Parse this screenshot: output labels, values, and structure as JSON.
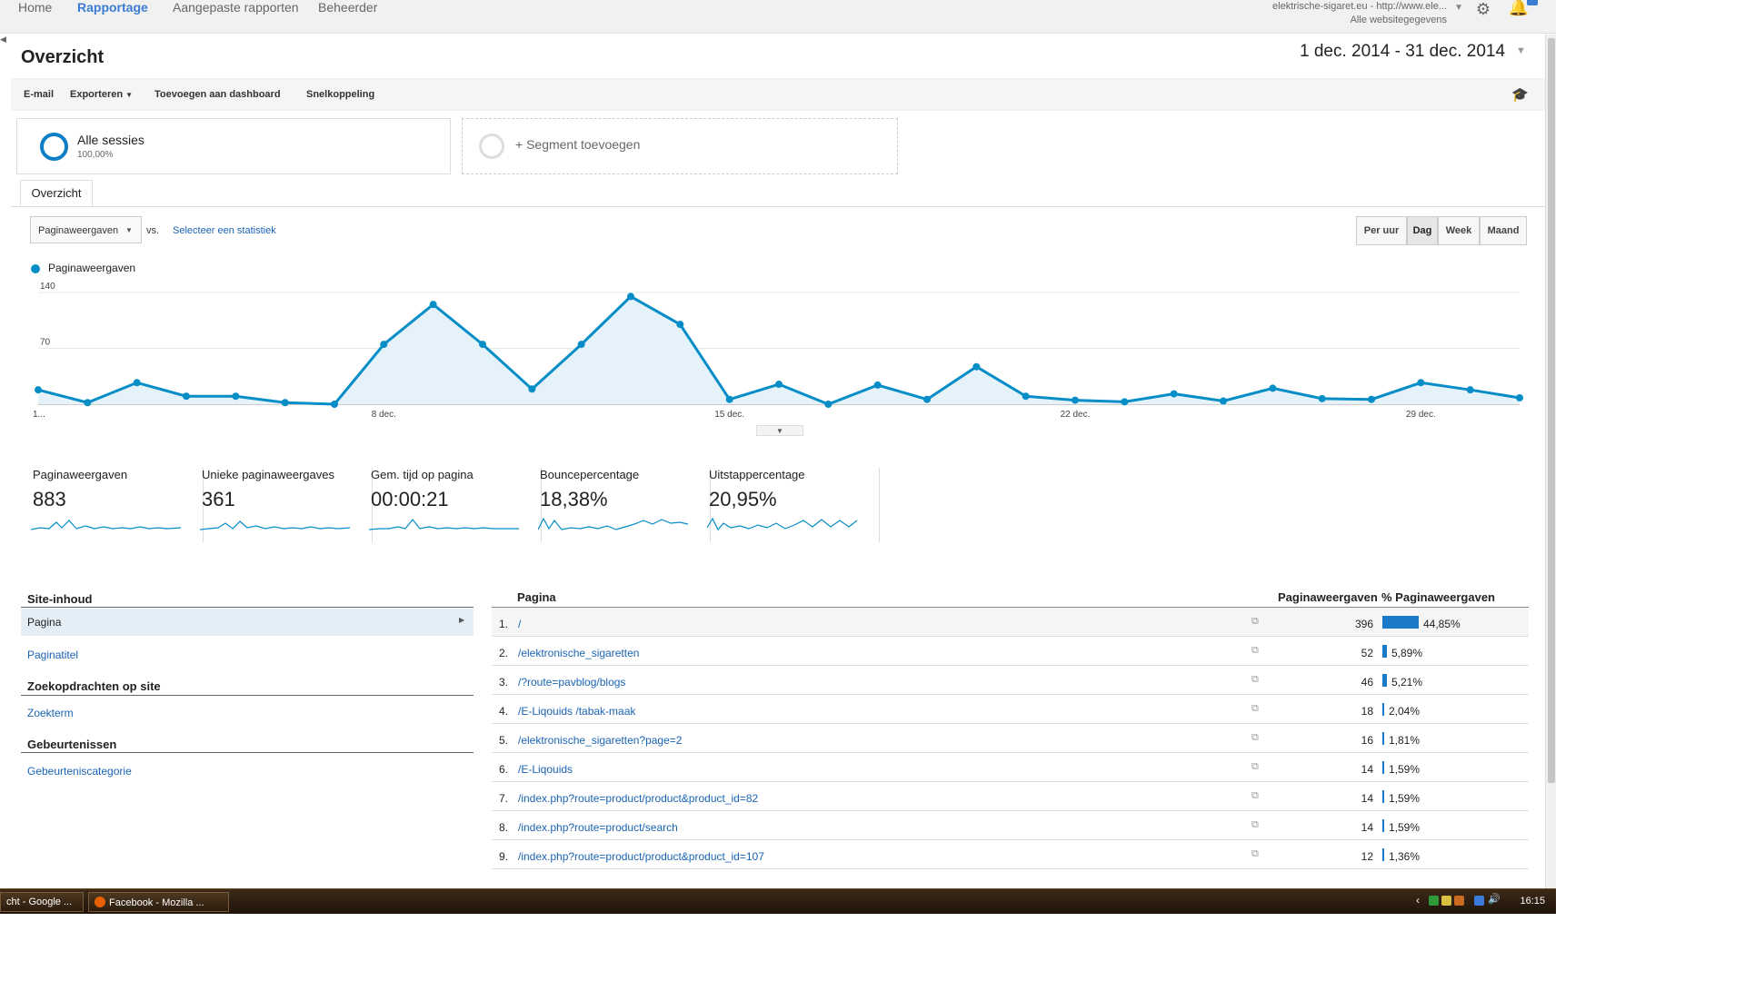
{
  "nav": {
    "home": "Home",
    "rapportage": "Rapportage",
    "aangepaste": "Aangepaste rapporten",
    "beheerder": "Beheerder"
  },
  "account": {
    "site": "elektrische-sigaret.eu - http://www.ele...",
    "view": "Alle websitegegevens"
  },
  "header": {
    "title": "Overzicht",
    "date_range": "1 dec. 2014 - 31 dec. 2014"
  },
  "toolbar": {
    "email": "E-mail",
    "export": "Exporteren",
    "add_dashboard": "Toevoegen aan dashboard",
    "shortcut": "Snelkoppeling"
  },
  "segments": {
    "active_title": "Alle sessies",
    "active_pct": "100,00%",
    "add": "+ Segment toevoegen"
  },
  "tabs": {
    "overview": "Overzicht"
  },
  "metric_controls": {
    "selected_metric": "Paginaweergaven",
    "vs": "vs.",
    "select_stat": "Selecteer een statistiek",
    "granularity": [
      "Per uur",
      "Dag",
      "Week",
      "Maand"
    ],
    "active_granularity": "Dag"
  },
  "colors": {
    "accent": "#058dc7",
    "link": "#1a64b4",
    "bar": "#1a7ac9"
  },
  "chart_data": {
    "type": "area",
    "series": [
      {
        "name": "Paginaweergaven",
        "values": [
          18,
          2,
          27,
          10,
          10,
          2,
          0,
          75,
          125,
          75,
          19,
          75,
          135,
          100,
          6,
          25,
          0,
          24,
          6,
          47,
          10,
          5,
          3,
          13,
          4,
          20,
          7,
          6,
          27,
          18,
          8
        ]
      }
    ],
    "x": [
      "1 dec.",
      "2 dec.",
      "3 dec.",
      "4 dec.",
      "5 dec.",
      "6 dec.",
      "7 dec.",
      "8 dec.",
      "9 dec.",
      "10 dec.",
      "11 dec.",
      "12 dec.",
      "13 dec.",
      "14 dec.",
      "15 dec.",
      "16 dec.",
      "17 dec.",
      "18 dec.",
      "19 dec.",
      "20 dec.",
      "21 dec.",
      "22 dec.",
      "23 dec.",
      "24 dec.",
      "25 dec.",
      "26 dec.",
      "27 dec.",
      "28 dec.",
      "29 dec.",
      "30 dec.",
      "31 dec."
    ],
    "x_tick_labels": [
      "1...",
      "8 dec.",
      "15 dec.",
      "22 dec.",
      "29 dec."
    ],
    "y_tick_labels": [
      "140",
      "70"
    ],
    "ylim": [
      0,
      140
    ],
    "grid": true,
    "legend": "top-left"
  },
  "scorecards": [
    {
      "label": "Paginaweergaven",
      "value": "883"
    },
    {
      "label": "Unieke paginaweergaves",
      "value": "361"
    },
    {
      "label": "Gem. tijd op pagina",
      "value": "00:00:21"
    },
    {
      "label": "Bouncepercentage",
      "value": "18,38%"
    },
    {
      "label": "Uitstappercentage",
      "value": "20,95%"
    }
  ],
  "left_panel": {
    "site_content": "Site-inhoud",
    "pagina": "Pagina",
    "paginatitel": "Paginatitel",
    "search_head": "Zoekopdrachten op site",
    "zoekterm": "Zoekterm",
    "events_head": "Gebeurtenissen",
    "event_category": "Gebeurteniscategorie"
  },
  "table": {
    "col_page": "Pagina",
    "col_pv": "Paginaweergaven",
    "col_pct": "% Paginaweergaven",
    "rows": [
      {
        "num": "1.",
        "page": "/",
        "pv": "396",
        "pct": "44,85%",
        "share": 0.4485
      },
      {
        "num": "2.",
        "page": "/elektronische_sigaretten",
        "pv": "52",
        "pct": "5,89%",
        "share": 0.0589
      },
      {
        "num": "3.",
        "page": "/?route=pavblog/blogs",
        "pv": "46",
        "pct": "5,21%",
        "share": 0.0521
      },
      {
        "num": "4.",
        "page": "/E-Liqouids /tabak-maak",
        "pv": "18",
        "pct": "2,04%",
        "share": 0.0204
      },
      {
        "num": "5.",
        "page": "/elektronische_sigaretten?page=2",
        "pv": "16",
        "pct": "1,81%",
        "share": 0.0181
      },
      {
        "num": "6.",
        "page": "/E-Liqouids",
        "pv": "14",
        "pct": "1,59%",
        "share": 0.0159
      },
      {
        "num": "7.",
        "page": "/index.php?route=product/product&product_id=82",
        "pv": "14",
        "pct": "1,59%",
        "share": 0.0159
      },
      {
        "num": "8.",
        "page": "/index.php?route=product/search",
        "pv": "14",
        "pct": "1,59%",
        "share": 0.0159
      },
      {
        "num": "9.",
        "page": "/index.php?route=product/product&product_id=107",
        "pv": "12",
        "pct": "1,36%",
        "share": 0.0136
      }
    ]
  },
  "taskbar": {
    "task1": "cht - Google ...",
    "task2": "Facebook - Mozilla ...",
    "clock": "16:15"
  }
}
